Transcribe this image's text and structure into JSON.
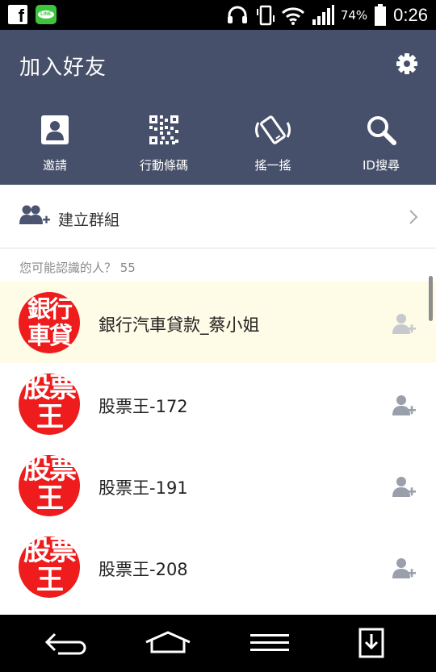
{
  "status_bar": {
    "battery_percent": "74%",
    "time": "0:26",
    "icons": [
      "facebook-icon",
      "line-icon",
      "headset-icon",
      "vibrate-icon",
      "wifi-icon",
      "signal-icon",
      "battery-icon"
    ]
  },
  "header": {
    "title": "加入好友",
    "settings_icon": "gear-icon",
    "actions": [
      {
        "label": "邀請",
        "icon": "contact-card-icon"
      },
      {
        "label": "行動條碼",
        "icon": "qr-code-icon"
      },
      {
        "label": "搖一搖",
        "icon": "shake-phone-icon"
      },
      {
        "label": "ID搜尋",
        "icon": "search-icon"
      }
    ]
  },
  "create_group": {
    "label": "建立群組",
    "icon": "add-group-icon"
  },
  "suggestions": {
    "heading": "您可能認識的人？ 55",
    "items": [
      {
        "name": "銀行汽車貸款_蔡小姐",
        "avatar_lines": [
          "銀行",
          "車貸"
        ],
        "highlighted": true
      },
      {
        "name": "股票王-172",
        "avatar_lines": [
          "股票",
          "王"
        ],
        "highlighted": false
      },
      {
        "name": "股票王-191",
        "avatar_lines": [
          "股票",
          "王"
        ],
        "highlighted": false
      },
      {
        "name": "股票王-208",
        "avatar_lines": [
          "股票",
          "王"
        ],
        "highlighted": false
      }
    ]
  },
  "colors": {
    "header_bg": "#47506a",
    "avatar_red": "#ee1c1c",
    "highlight_row": "#fefbe6"
  }
}
